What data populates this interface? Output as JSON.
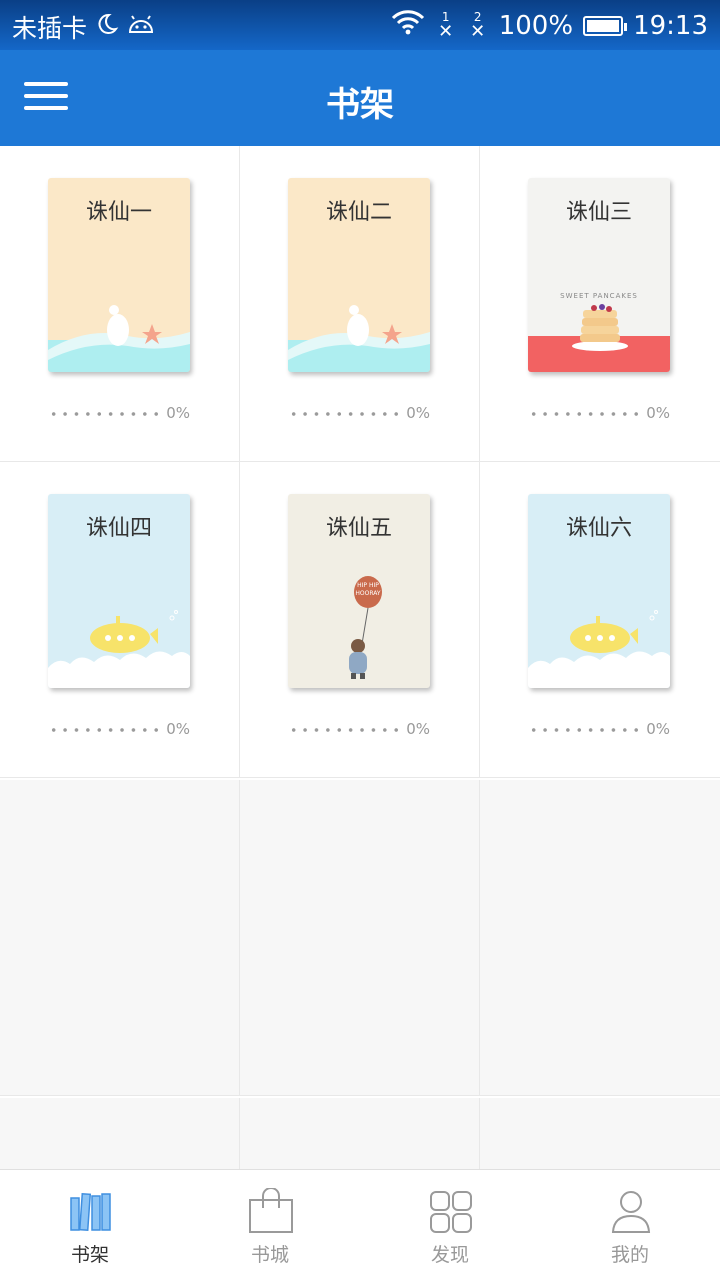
{
  "status_bar": {
    "carrier": "未插卡",
    "sim1": "1",
    "sim2": "2",
    "battery": "100%",
    "time": "19:13"
  },
  "app_bar": {
    "title": "书架"
  },
  "books": [
    {
      "title": "诛仙一",
      "progress": "0%",
      "cover": "goose"
    },
    {
      "title": "诛仙二",
      "progress": "0%",
      "cover": "goose"
    },
    {
      "title": "诛仙三",
      "progress": "0%",
      "cover": "pancakes"
    },
    {
      "title": "诛仙四",
      "progress": "0%",
      "cover": "submarine"
    },
    {
      "title": "诛仙五",
      "progress": "0%",
      "cover": "bear-balloon"
    },
    {
      "title": "诛仙六",
      "progress": "0%",
      "cover": "submarine"
    }
  ],
  "covers": {
    "pancakes_caption": "SWEET PANCAKES",
    "balloon_caption_1": "HIP HIP",
    "balloon_caption_2": "HOORAY"
  },
  "bottom_nav": [
    {
      "label": "书架",
      "icon": "bookshelf-icon",
      "active": true
    },
    {
      "label": "书城",
      "icon": "shopping-bag-icon",
      "active": false
    },
    {
      "label": "发现",
      "icon": "grid-icon",
      "active": false
    },
    {
      "label": "我的",
      "icon": "user-icon",
      "active": false
    }
  ],
  "colors": {
    "primary": "#1e78d6",
    "status_bar": "#0a3f86",
    "active_tab_icon": "#4a9ef0"
  }
}
